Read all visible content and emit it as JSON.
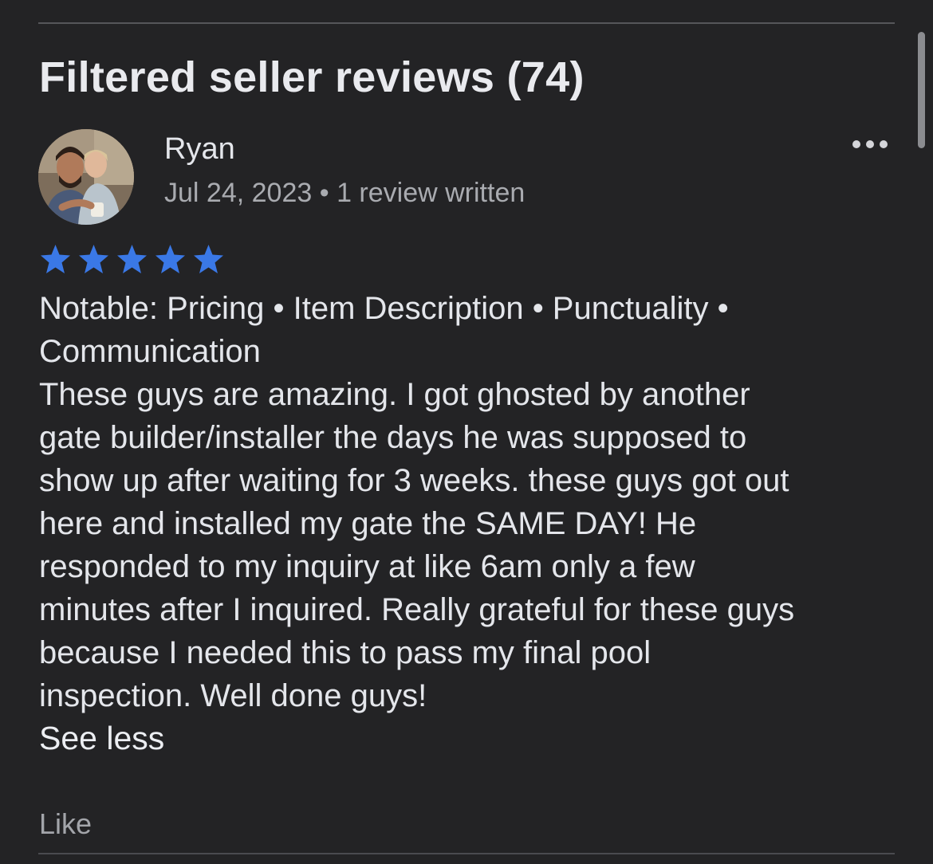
{
  "section": {
    "title": "Filtered seller reviews (74)"
  },
  "review": {
    "reviewer_name": "Ryan",
    "date": "Jul 24, 2023",
    "separator": "•",
    "reviews_written": "1 review written",
    "rating": 5,
    "rating_max": 5,
    "star_color": "#3a78e6",
    "notable_label": "Notable:",
    "notable_line1": "Notable: Pricing • Item Description • Punctuality •",
    "notable_line2": "Communication",
    "body_lines": [
      "These guys are amazing. I got ghosted by another",
      "gate builder/installer the days he was supposed to",
      "show up after waiting for 3 weeks. these guys got out",
      "here and installed my gate the SAME DAY! He",
      "responded to my inquiry at like 6am only a few",
      "minutes after I inquired. Really grateful for these guys",
      "because I needed this to pass my final pool",
      "inspection. Well done guys!"
    ],
    "see_less_label": "See less",
    "like_label": "Like",
    "more_icon": "more-horizontal-icon"
  },
  "colors": {
    "background": "#232325",
    "primary_text": "#e4e6eb",
    "secondary_text": "#a9abb0",
    "star": "#3a78e6"
  }
}
